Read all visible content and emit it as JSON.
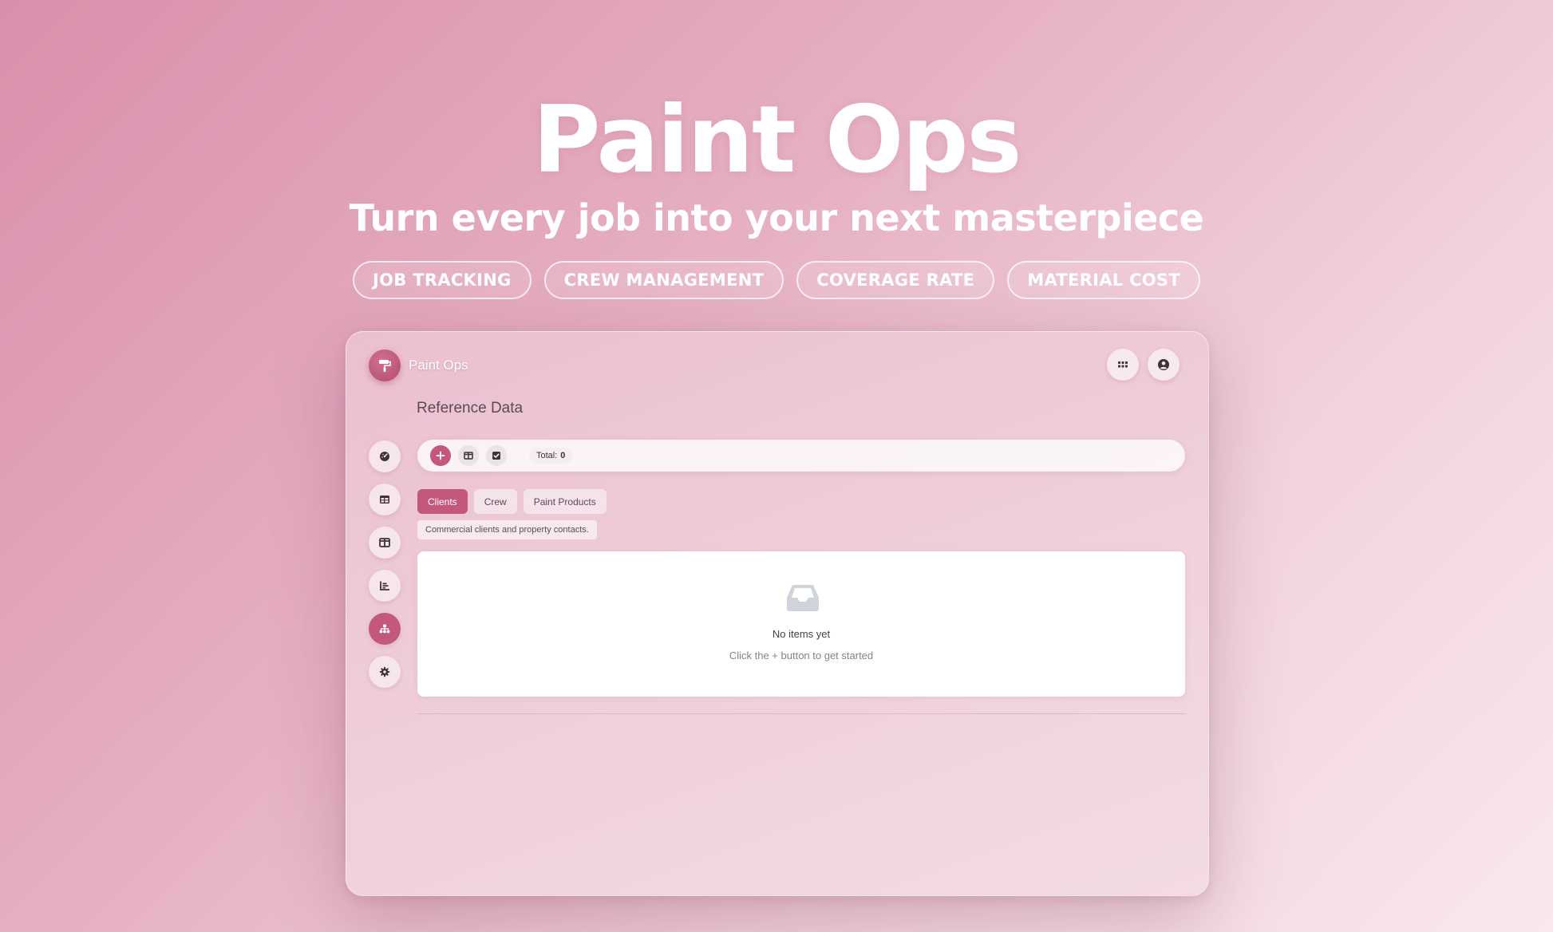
{
  "hero": {
    "title": "Paint Ops",
    "subtitle": "Turn every job into your next masterpiece",
    "features": [
      "JOB TRACKING",
      "CREW MANAGEMENT",
      "COVERAGE RATE",
      "MATERIAL COST"
    ]
  },
  "app": {
    "name": "Paint Ops",
    "logo_icon": "paint-roller-icon",
    "header_buttons": [
      {
        "icon": "apps-grid-icon"
      },
      {
        "icon": "user-account-icon"
      }
    ],
    "page_title": "Reference Data",
    "sidebar": [
      {
        "icon": "dashboard-gauge-icon",
        "active": false
      },
      {
        "icon": "table-icon",
        "active": false
      },
      {
        "icon": "columns-icon",
        "active": false
      },
      {
        "icon": "chart-icon",
        "active": false
      },
      {
        "icon": "hierarchy-icon",
        "active": true
      },
      {
        "icon": "gear-icon",
        "active": false
      }
    ],
    "toolbar": {
      "total_label": "Total:",
      "total_value": "0"
    },
    "tabs": [
      {
        "label": "Clients",
        "active": true
      },
      {
        "label": "Crew",
        "active": false
      },
      {
        "label": "Paint Products",
        "active": false
      }
    ],
    "tab_description": "Commercial clients and property contacts.",
    "empty_state": {
      "icon": "inbox-icon",
      "title": "No items yet",
      "hint": "Click the + button to get started"
    }
  },
  "colors": {
    "accent": "#c4587c",
    "background_start": "#d98fab",
    "background_end": "#f9e7ee"
  }
}
